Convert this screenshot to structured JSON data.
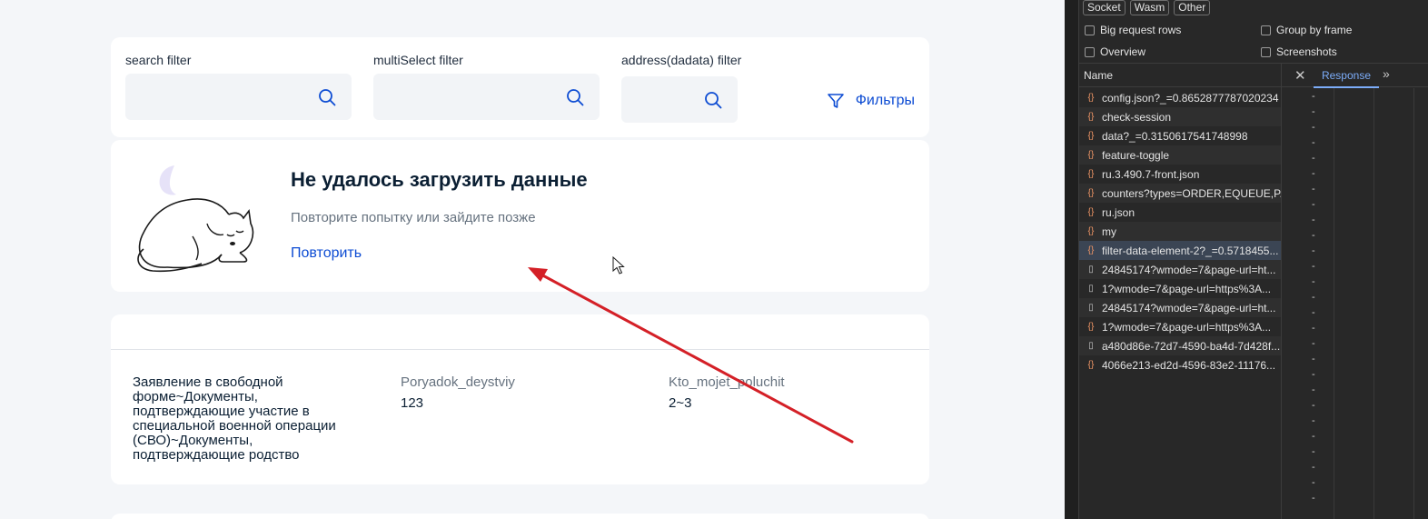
{
  "filters": {
    "search": {
      "label": "search filter"
    },
    "multiselect": {
      "label": "multiSelect filter"
    },
    "address": {
      "label": "address(dadata) filter"
    },
    "button_label": "Фильтры"
  },
  "error": {
    "title": "Не удалось загрузить данные",
    "subtitle": "Повторите попытку или зайдите позже",
    "retry": "Повторить"
  },
  "table": {
    "row": {
      "main_text": "Заявление в свободной форме~Документы, подтверждающие участие в специальной военной операции (СВО)~Документы, подтверждающие родство",
      "col2_label": "Poryadok_deystviy",
      "col2_value": "123",
      "col3_label": "Kto_mojet_poluchit",
      "col3_value": "2~3"
    }
  },
  "devtools": {
    "chips": [
      "Socket",
      "Wasm",
      "Other"
    ],
    "checkboxes": {
      "big_rows": "Big request rows",
      "group_by_frame": "Group by frame",
      "overview": "Overview",
      "screenshots": "Screenshots"
    },
    "name_header": "Name",
    "response_tab": "Response",
    "requests": [
      {
        "label": "config.json?_=0.8652877787020234",
        "type": "json"
      },
      {
        "label": "check-session",
        "type": "json"
      },
      {
        "label": "data?_=0.3150617541748998",
        "type": "json"
      },
      {
        "label": "feature-toggle",
        "type": "json"
      },
      {
        "label": "ru.3.490.7-front.json",
        "type": "json"
      },
      {
        "label": "counters?types=ORDER,EQUEUE,P...",
        "type": "json"
      },
      {
        "label": "ru.json",
        "type": "json"
      },
      {
        "label": "my",
        "type": "json"
      },
      {
        "label": "filter-data-element-2?_=0.5718455...",
        "type": "json"
      },
      {
        "label": "24845174?wmode=7&page-url=ht...",
        "type": "doc"
      },
      {
        "label": "1?wmode=7&page-url=https%3A...",
        "type": "doc"
      },
      {
        "label": "24845174?wmode=7&page-url=ht...",
        "type": "doc"
      },
      {
        "label": "1?wmode=7&page-url=https%3A...",
        "type": "json"
      },
      {
        "label": "a480d86e-72d7-4590-ba4d-7d428f...",
        "type": "doc"
      },
      {
        "label": "4066e213-ed2d-4596-83e2-11176...",
        "type": "json"
      }
    ],
    "dash": "-",
    "colors": {
      "accent": "#7cacf8",
      "json_icon": "#f29766"
    }
  },
  "colors": {
    "link": "#0d4cd3",
    "annotation_arrow": "#d42027"
  }
}
